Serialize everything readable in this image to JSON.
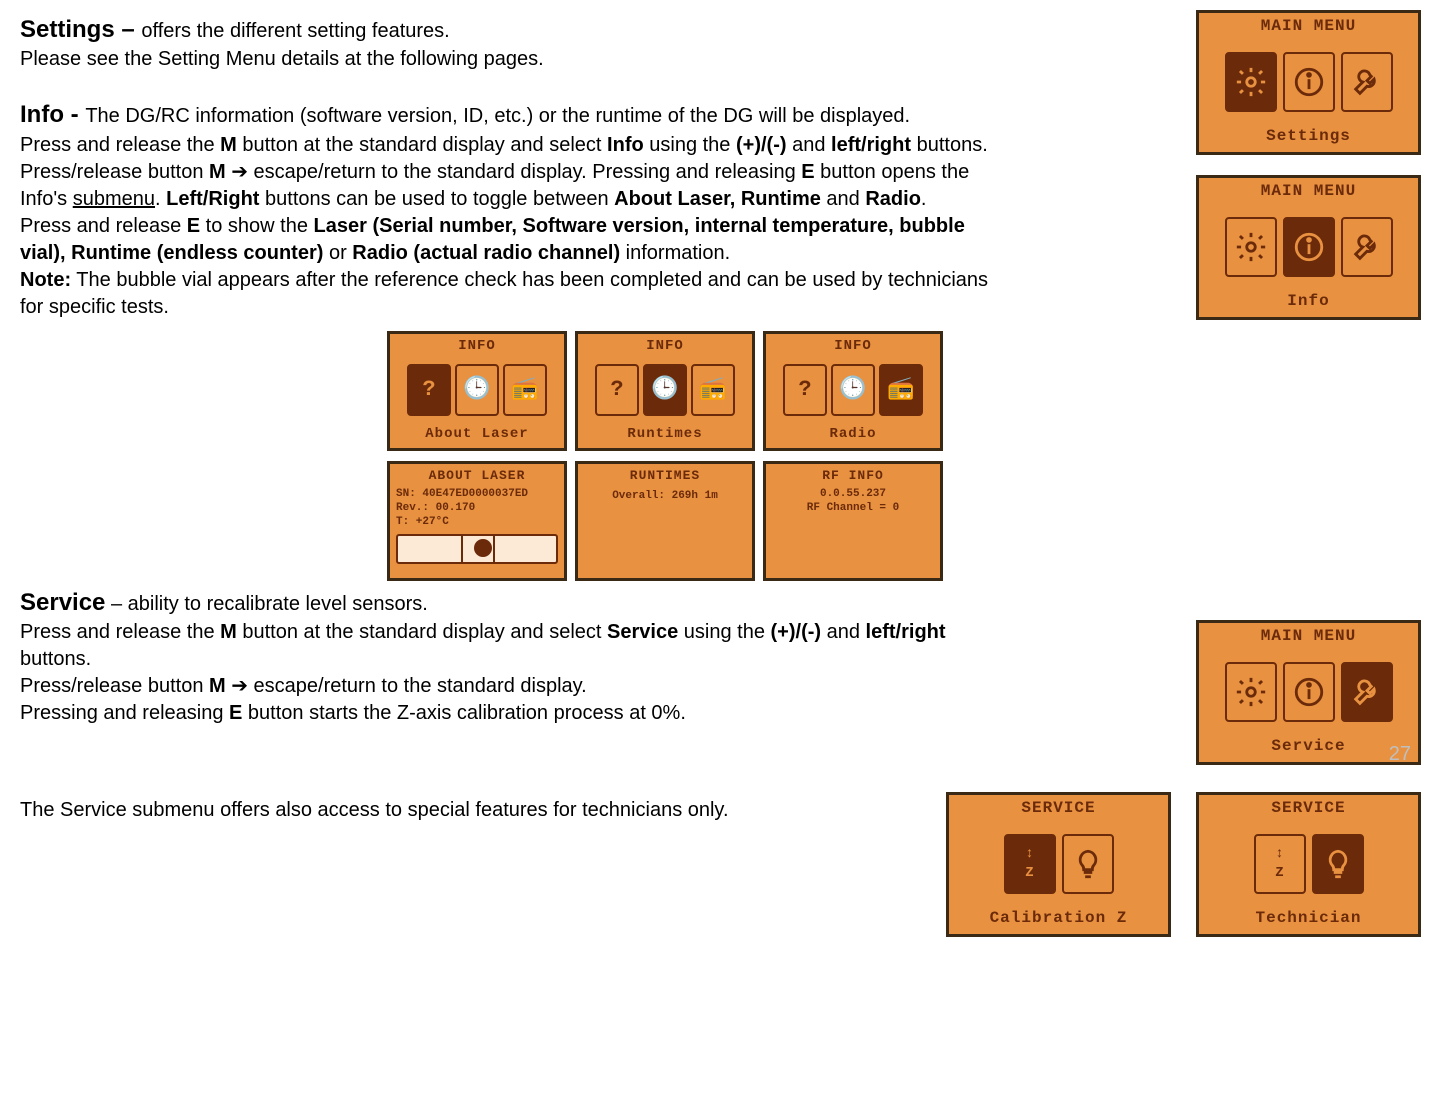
{
  "page_number": "27",
  "settings": {
    "heading": "Settings",
    "dash": " – ",
    "desc": "offers the different setting features.",
    "line2": "Please see the Setting Menu details at the following pages."
  },
  "info": {
    "heading": "Info",
    "dash": " - ",
    "desc": "The DG/RC information (software version, ID, etc.) or the runtime of the DG will be displayed.",
    "p2a": "Press and release the ",
    "p2b_M": "M",
    "p2c": " button at the standard display and select ",
    "p2d_Info": "Info",
    "p2e": " using the ",
    "p2f_plusminus": "(+)/(-)",
    "p2g": " and ",
    "p2h_lr": "left/right",
    "p2i": " buttons. Press/release button ",
    "p2j_M": "M",
    "p2k_arrow": " ➔ ",
    "p2l": "escape/return to the standard display. Pressing and releasing ",
    "p2m_E": "E",
    "p2n": " button opens the Info's ",
    "p2o_submenu": "submenu",
    "p2p": ". ",
    "p2q_LR": "Left/Right",
    "p2r": " buttons can be used to toggle between ",
    "p2s_ALR": "About Laser, Runtime",
    "p2t": " and ",
    "p2u_Radio": "Radio",
    "p2v": ".",
    "p3a": "Press and release ",
    "p3b_E": "E",
    "p3c": " to show the ",
    "p3d_bold": "Laser (Serial number, Software version, internal temperature, bubble vial), Runtime (endless counter)",
    "p3e": " or ",
    "p3f_bold": "Radio (actual radio channel)",
    "p3g": " information.",
    "note_label": "Note:",
    "note_text": " The bubble vial appears after the reference check has been completed and can be used by technicians for specific tests."
  },
  "service": {
    "heading": "Service",
    "dash": " – ",
    "desc": "ability to recalibrate level sensors.",
    "p2a": "Press and release the ",
    "p2b_M": "M",
    "p2c": " button at the standard display and select ",
    "p2d_Service": "Service",
    "p2e": " using the ",
    "p2f_plusminus": "(+)/(-)",
    "p2g": " and ",
    "p2h_lr": "left/right",
    "p2i": " buttons.",
    "p3a": "Press/release button ",
    "p3b_M": "M",
    "p3c_arrow": " ➔ ",
    "p3d": "escape/return to the standard display.",
    "p4a": "Pressing and releasing ",
    "p4b_E": "E",
    "p4c": " button starts the Z-axis calibration process at 0%.",
    "last": "The Service submenu offers also access to special features for technicians only."
  },
  "lcd": {
    "main_menu": "MAIN MENU",
    "settings": "Settings",
    "info": "Info",
    "service": "Service",
    "info_title": "INFO",
    "about_laser": "About Laser",
    "runtimes": "Runtimes",
    "radio": "Radio",
    "about_laser_title": "ABOUT LASER",
    "sn_line": "SN: 40E47ED0000037ED",
    "rev_line": "Rev.: 00.170",
    "temp_line": "T: +27°C",
    "runtimes_title": "RUNTIMES",
    "runtimes_line": "Overall: 269h 1m",
    "rfinfo_title": "RF INFO",
    "rf_ver": "0.0.55.237",
    "rf_chan": "RF Channel = 0",
    "service_title": "SERVICE",
    "calibration_z": "Calibration Z",
    "technician": "Technician"
  }
}
